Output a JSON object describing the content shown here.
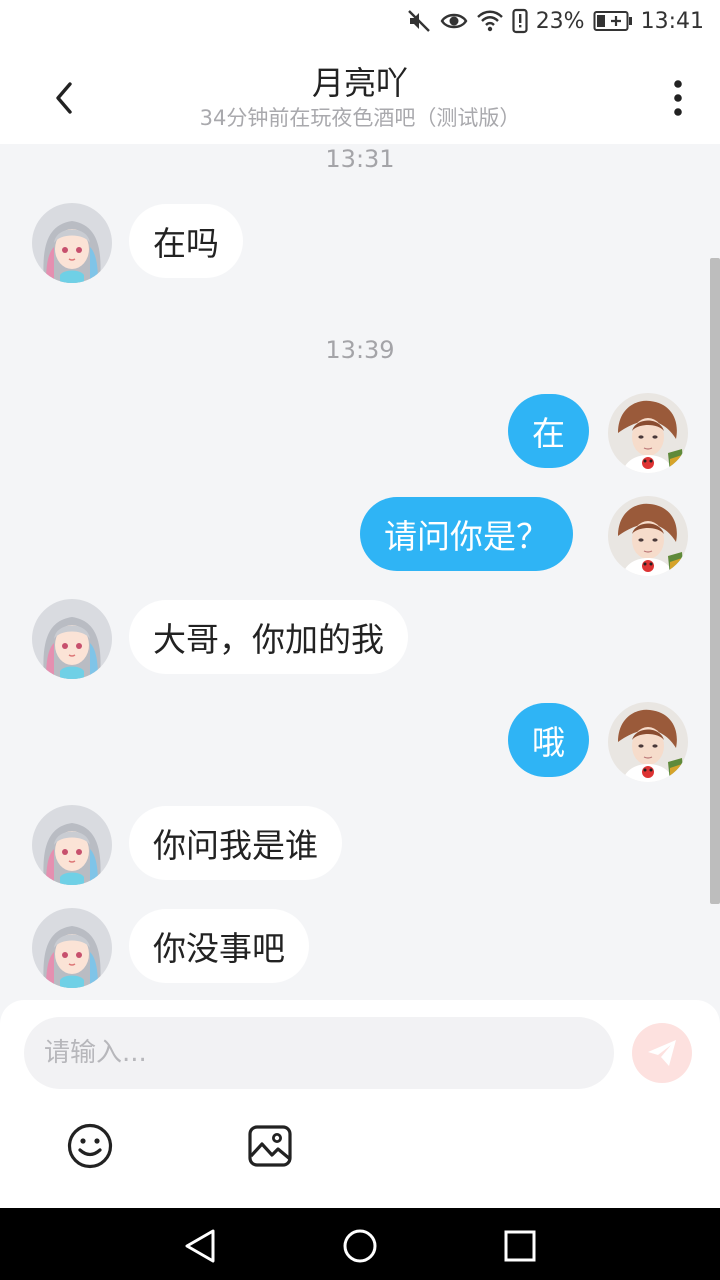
{
  "status_bar": {
    "battery": "23%",
    "time": "13:41"
  },
  "header": {
    "title": "月亮吖",
    "subtitle": "34分钟前在玩夜色酒吧（测试版）"
  },
  "messages": {
    "time1": "13:31",
    "time2": "13:39",
    "m1": "在吗",
    "m2": "在",
    "m3": "请问你是？",
    "m4": "大哥，你加的我",
    "m5": "哦",
    "m6": "你问我是谁",
    "m7": "你没事吧"
  },
  "composer": {
    "placeholder": "请输入..."
  },
  "colors": {
    "outgoing_bubble": "#2fb4f5",
    "incoming_bubble": "#ffffff",
    "send_button": "#fde1df"
  }
}
